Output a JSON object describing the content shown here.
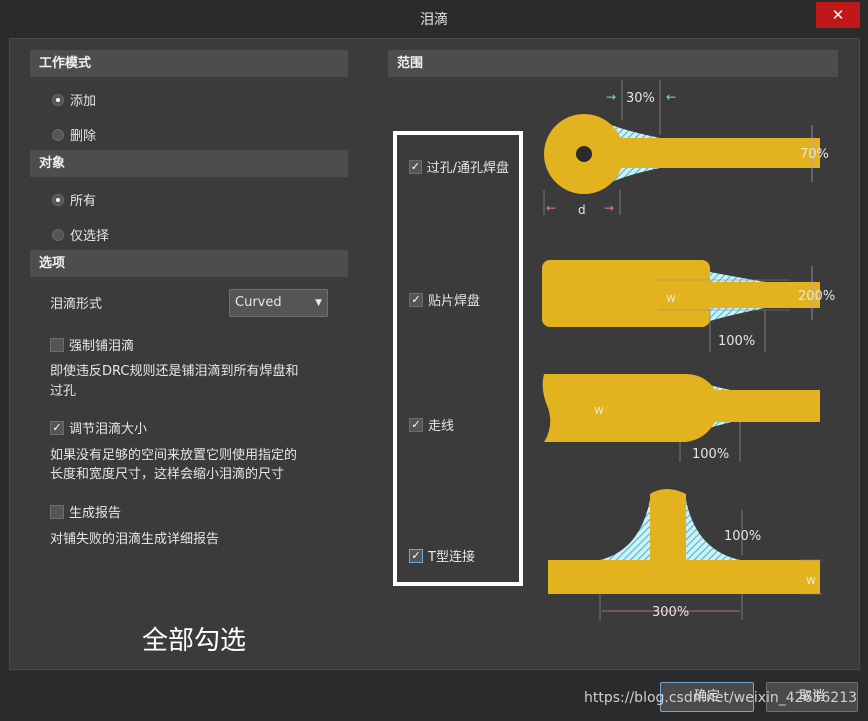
{
  "window": {
    "title": "泪滴",
    "close_icon": "close-icon"
  },
  "work_mode": {
    "header": "工作模式",
    "options": [
      {
        "label": "添加",
        "selected": true
      },
      {
        "label": "删除",
        "selected": false
      }
    ]
  },
  "objects": {
    "header": "对象",
    "options": [
      {
        "label": "所有",
        "selected": true
      },
      {
        "label": "仅选择",
        "selected": false
      }
    ]
  },
  "options": {
    "header": "选项",
    "style_label": "泪滴形式",
    "style_value": "Curved",
    "force": {
      "label": "强制铺泪滴",
      "checked": false,
      "desc1": "即使违反DRC规则还是铺泪滴到所有焊盘和",
      "desc2": "过孔"
    },
    "adjust": {
      "label": "调节泪滴大小",
      "checked": true,
      "desc1": "如果没有足够的空间来放置它则使用指定的",
      "desc2": "长度和宽度尺寸，这样会缩小泪滴的尺寸"
    },
    "report": {
      "label": "生成报告",
      "checked": false,
      "desc": "对铺失败的泪滴生成详细报告"
    }
  },
  "scope": {
    "header": "范围",
    "items": [
      {
        "label": "过孔/通孔焊盘",
        "checked": true
      },
      {
        "label": "贴片焊盘",
        "checked": true
      },
      {
        "label": "走线",
        "checked": true
      },
      {
        "label": "T型连接",
        "checked": true
      }
    ]
  },
  "diagram_labels": {
    "via_top": "30%",
    "via_right": "70%",
    "via_d": "d",
    "smd_w": "w",
    "smd_right": "200%",
    "smd_bottom": "100%",
    "track_w": "w",
    "track_bottom": "100%",
    "t_right": "100%",
    "t_w": "w",
    "t_bottom": "300%"
  },
  "annotation": "全部勾选",
  "buttons": {
    "ok": "确定",
    "cancel": "取消"
  },
  "watermark": "https://blog.csdn.net/weixin_42656213",
  "colors": {
    "copper": "#e3b21f",
    "teardrop_hatch": "#9fe3ef",
    "close": "#c01818",
    "frame": "#ffffff"
  }
}
